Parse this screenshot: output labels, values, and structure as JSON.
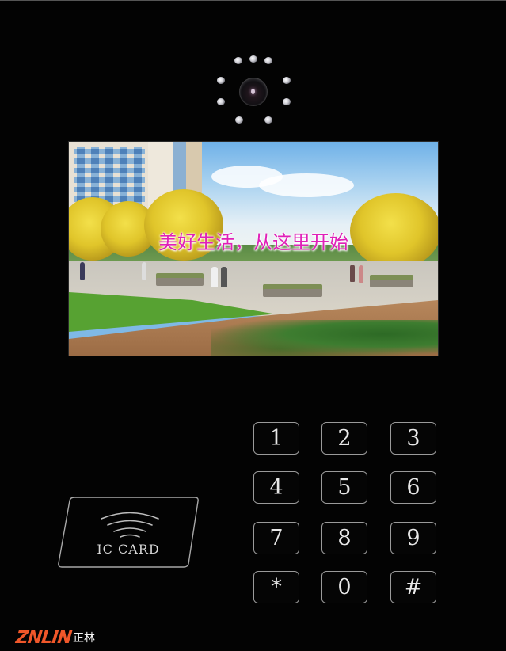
{
  "device": {
    "type": "building intercom door station",
    "colors": {
      "panel": "#030303",
      "key_border": "#9a9a9a",
      "key_text": "#e8e8e8",
      "caption": "#e020b8",
      "brand": "#f0572a"
    }
  },
  "camera": {
    "icon": "camera-lens-icon",
    "led_count": 9,
    "led_icon": "infrared-led-icon"
  },
  "screen": {
    "caption": "美好生活，从这里开始",
    "scene": "landscaped residential plaza with yellow trees, lawn and pedestrians"
  },
  "keypad": {
    "keys": [
      {
        "label": "1"
      },
      {
        "label": "2"
      },
      {
        "label": "3"
      },
      {
        "label": "4"
      },
      {
        "label": "5"
      },
      {
        "label": "6"
      },
      {
        "label": "7"
      },
      {
        "label": "8"
      },
      {
        "label": "9"
      },
      {
        "label": "*"
      },
      {
        "label": "0"
      },
      {
        "label": "#"
      }
    ]
  },
  "ic_card": {
    "label": "IC CARD",
    "icon": "wireless-signal-icon"
  },
  "brand": {
    "logo_text": "ZNLIN",
    "logo_cn": "正林"
  }
}
